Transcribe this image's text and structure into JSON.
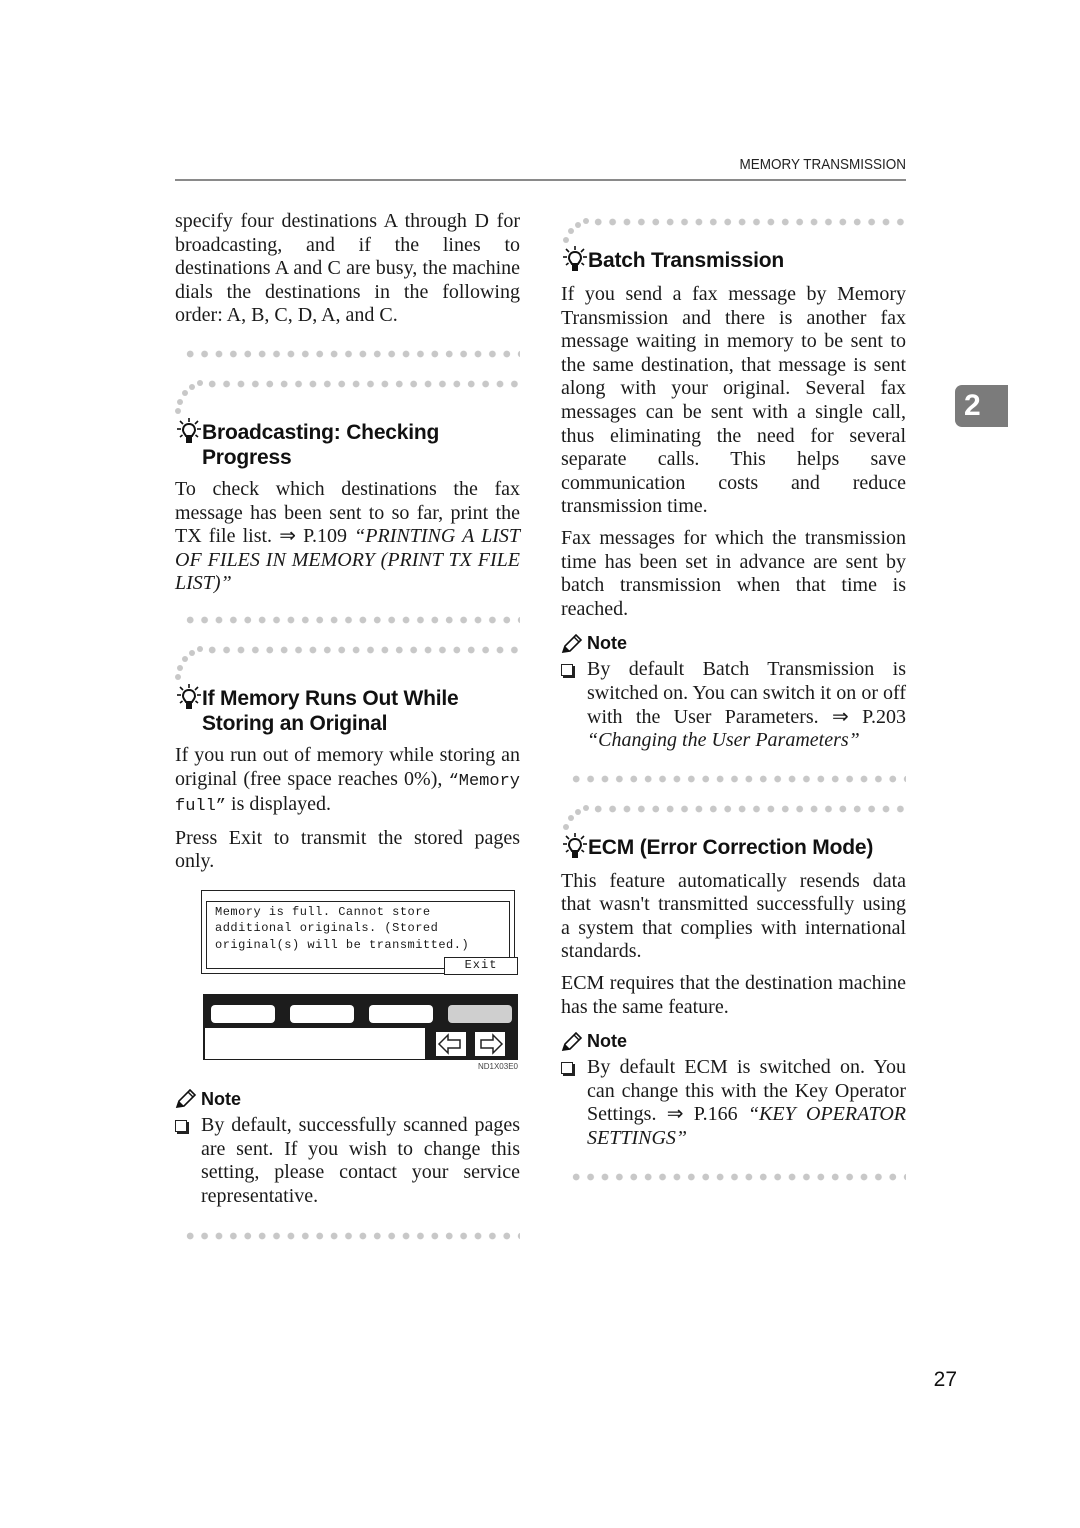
{
  "header": {
    "running_title": "MEMORY TRANSMISSION"
  },
  "chapter_tab": "2",
  "page_number": "27",
  "left_column": {
    "intro_paragraph": "specify four destinations A through D for broadcasting, and if the lines to destinations A and C are busy, the machine dials the destinations in the following order: A, B, C, D, A, and C.",
    "section_broadcasting": {
      "icon": "lightbulb-icon",
      "title": "Broadcasting: Checking Progress",
      "body_plain": "To check which destinations the fax message has been sent to so far, print the TX file list. ⇒ P.109 ",
      "body_ref": "“PRINTING A LIST OF FILES IN MEMORY (PRINT TX FILE LIST)”"
    },
    "section_memory": {
      "icon": "lightbulb-icon",
      "title": "If Memory Runs Out While Storing an Original",
      "para1_pre": "If you run out of memory while storing an original (free space reaches 0%), ",
      "para1_code": "“Memory full”",
      "para1_post": " is displayed.",
      "para2": "Press Exit to transmit the stored pages only.",
      "lcd": {
        "message": "Memory is full. Cannot store\nadditional originals. (Stored\noriginal(s) will be transmitted.)",
        "exit_button": "Exit"
      },
      "panel": {
        "left_arrow": "left-arrow-icon",
        "right_arrow": "right-arrow-icon"
      },
      "figure_code": "ND1X03E0",
      "note": {
        "label": "Note",
        "icon": "pencil-icon",
        "items": [
          "By default, successfully scanned pages are sent. If you wish to change this setting, please contact your service representative."
        ]
      }
    }
  },
  "right_column": {
    "section_batch": {
      "icon": "lightbulb-icon",
      "title": "Batch Transmission",
      "para1": "If you send a fax message by Memory Transmission and there is another fax message waiting in memory to be sent to the same destination, that message is sent along with your original. Several fax messages can be sent with a single call, thus eliminating the need for several separate calls. This helps save communication costs and reduce transmission time.",
      "para2": "Fax messages for which the transmission time has been set in advance are sent by batch transmission when that time is reached.",
      "note": {
        "label": "Note",
        "icon": "pencil-icon",
        "item_plain": "By default Batch Transmission is switched on. You can switch it on or off with the User Parameters. ⇒ P.203 ",
        "item_ref": "“Changing the User Parameters”"
      }
    },
    "section_ecm": {
      "icon": "lightbulb-icon",
      "title": "ECM (Error Correction Mode)",
      "para1": "This feature automatically resends data that wasn't transmitted successfully using a system that complies with international standards.",
      "para2": "ECM requires that the destination machine has the same feature.",
      "note": {
        "label": "Note",
        "icon": "pencil-icon",
        "item_plain": "By default ECM is switched on. You can change this with the Key Operator Settings. ⇒ P.166 ",
        "item_ref": "“KEY OPERATOR SETTINGS”"
      }
    }
  }
}
